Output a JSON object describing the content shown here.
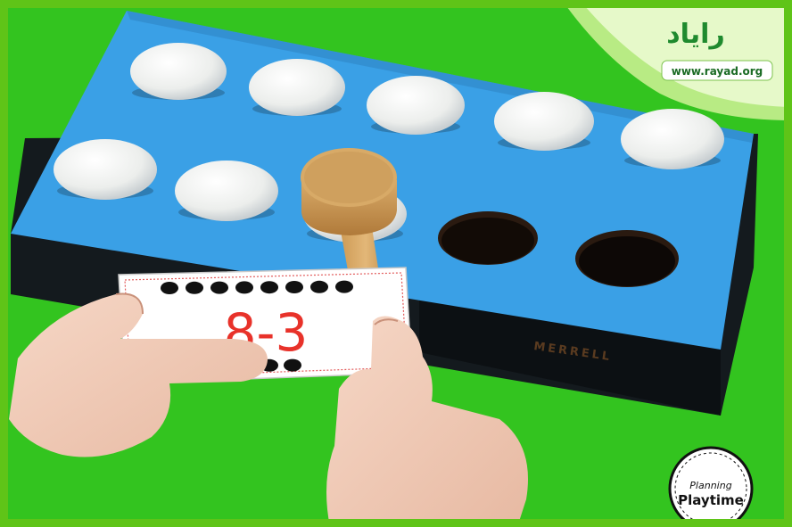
{
  "card": {
    "equation": "8-3",
    "top_dots": 8,
    "bottom_dots": 3
  },
  "brand": {
    "name": "MERRELL"
  },
  "watermark": {
    "site_logo_text": "رایاد",
    "site_url": "www.rayad.org",
    "corner_logo_line1": "Planning",
    "corner_logo_line2": "Playtime"
  },
  "colors": {
    "background": "#33c41f",
    "box_top": "#3aa0e6",
    "box_side": "#141a1e",
    "ball": "#f4f5f3",
    "equation_red": "#e8322a",
    "logo_green": "#1f8a2e"
  }
}
